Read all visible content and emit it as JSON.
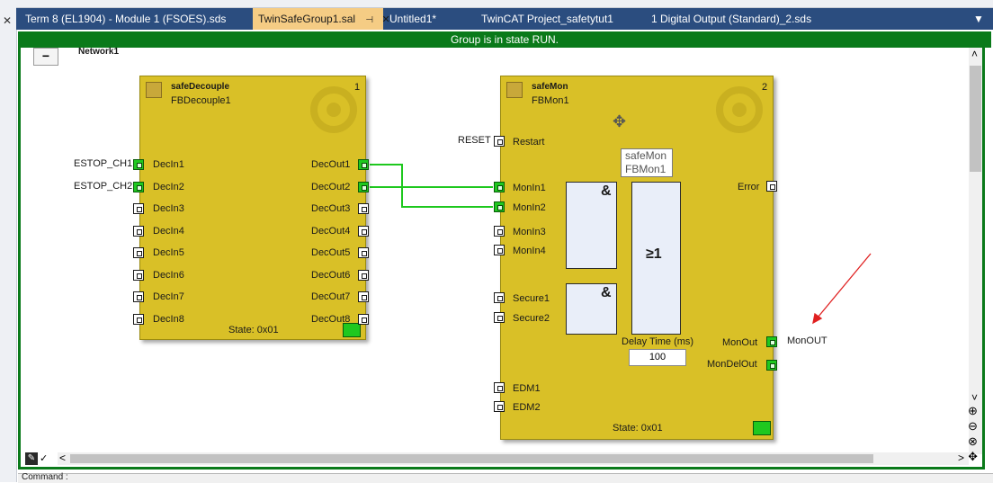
{
  "tabs": [
    {
      "label": "Term 8 (EL1904) - Module 1 (FSOES).sds",
      "active": false
    },
    {
      "label": "TwinSafeGroup1.sal",
      "active": true,
      "pin": "⊣",
      "close": "✕"
    },
    {
      "label": "Untitled1*",
      "active": false
    },
    {
      "label": "TwinCAT Project_safetytut1",
      "active": false
    },
    {
      "label": "1 Digital Output (Standard)_2.sds",
      "active": false
    }
  ],
  "left_close": "✕",
  "status_text": "Group is in state RUN.",
  "network": {
    "collapse": "−",
    "label": "Network1"
  },
  "fb1": {
    "title": "safeDecouple",
    "instance": "FBDecouple1",
    "number": "1",
    "inputs": [
      "DecIn1",
      "DecIn2",
      "DecIn3",
      "DecIn4",
      "DecIn5",
      "DecIn6",
      "DecIn7",
      "DecIn8"
    ],
    "outputs": [
      "DecOut1",
      "DecOut2",
      "DecOut3",
      "DecOut4",
      "DecOut5",
      "DecOut6",
      "DecOut7",
      "DecOut8"
    ],
    "external_inputs": [
      "ESTOP_CH1",
      "ESTOP_CH2"
    ],
    "state": "State: 0x01"
  },
  "fb2": {
    "title": "safeMon",
    "instance": "FBMon1",
    "number": "2",
    "reset_label": "RESET",
    "inputs": [
      "Restart",
      "MonIn1",
      "MonIn2",
      "MonIn3",
      "MonIn4",
      "Secure1",
      "Secure2",
      "EDM1",
      "EDM2"
    ],
    "outputs": [
      "Error",
      "MonOut",
      "MonDelOut"
    ],
    "external_output": "MonOUT",
    "and_symbol": "&",
    "or_symbol": "≥1",
    "delay_label": "Delay Time (ms)",
    "delay_value": "100",
    "state": "State: 0x01"
  },
  "tooltip": {
    "line1": "safeMon",
    "line2": "FBMon1"
  },
  "scroll": {
    "up": "˄",
    "down": "˅",
    "left": "<",
    "right": ">"
  },
  "zoom_tools": [
    "zoom-in-icon",
    "zoom-out-icon",
    "zoom-fit-icon",
    "pan-icon"
  ],
  "cmd_label": "Command :"
}
